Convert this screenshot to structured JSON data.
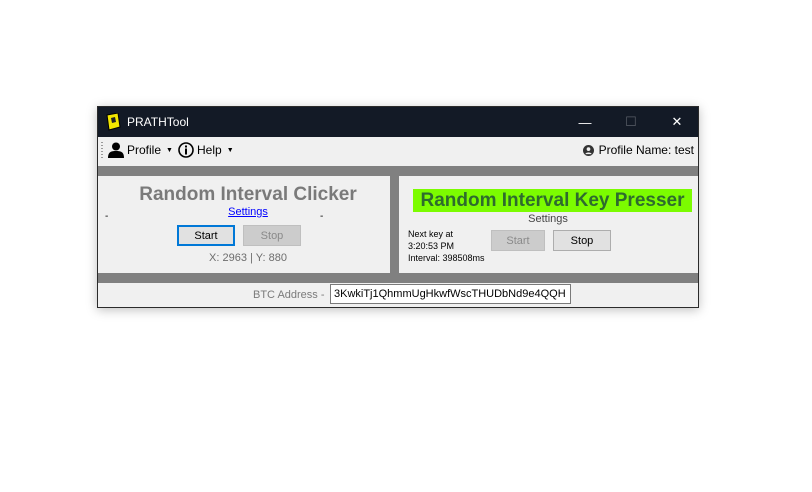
{
  "window": {
    "title": "PRATHTool",
    "controls": {
      "minimize": "—",
      "maximize": "☐",
      "close": "✕"
    }
  },
  "menu": {
    "profile_label": "Profile",
    "help_label": "Help",
    "profile_name": "Profile Name: test"
  },
  "clicker": {
    "title": "Random Interval Clicker",
    "settings_label": "Settings",
    "dash_left": "-",
    "dash_right": "-",
    "start_label": "Start",
    "stop_label": "Stop",
    "coords": "X: 2963 | Y: 880"
  },
  "presser": {
    "title": "Random Interval Key Presser",
    "title_bg": "#7cfc00",
    "settings_label": "Settings",
    "next_key_line1": "Next key at",
    "next_key_line2": "3:20:53 PM",
    "interval_text": "Interval: 398508ms",
    "start_label": "Start",
    "stop_label": "Stop"
  },
  "btc": {
    "label": "BTC Address -",
    "value": "3KwkiTj1QhmmUgHkwfWscTHUDbNd9e4QQH"
  },
  "icons": {
    "app": "app-icon",
    "profile": "user-icon",
    "help": "info-icon",
    "account": "account-circle-icon"
  }
}
